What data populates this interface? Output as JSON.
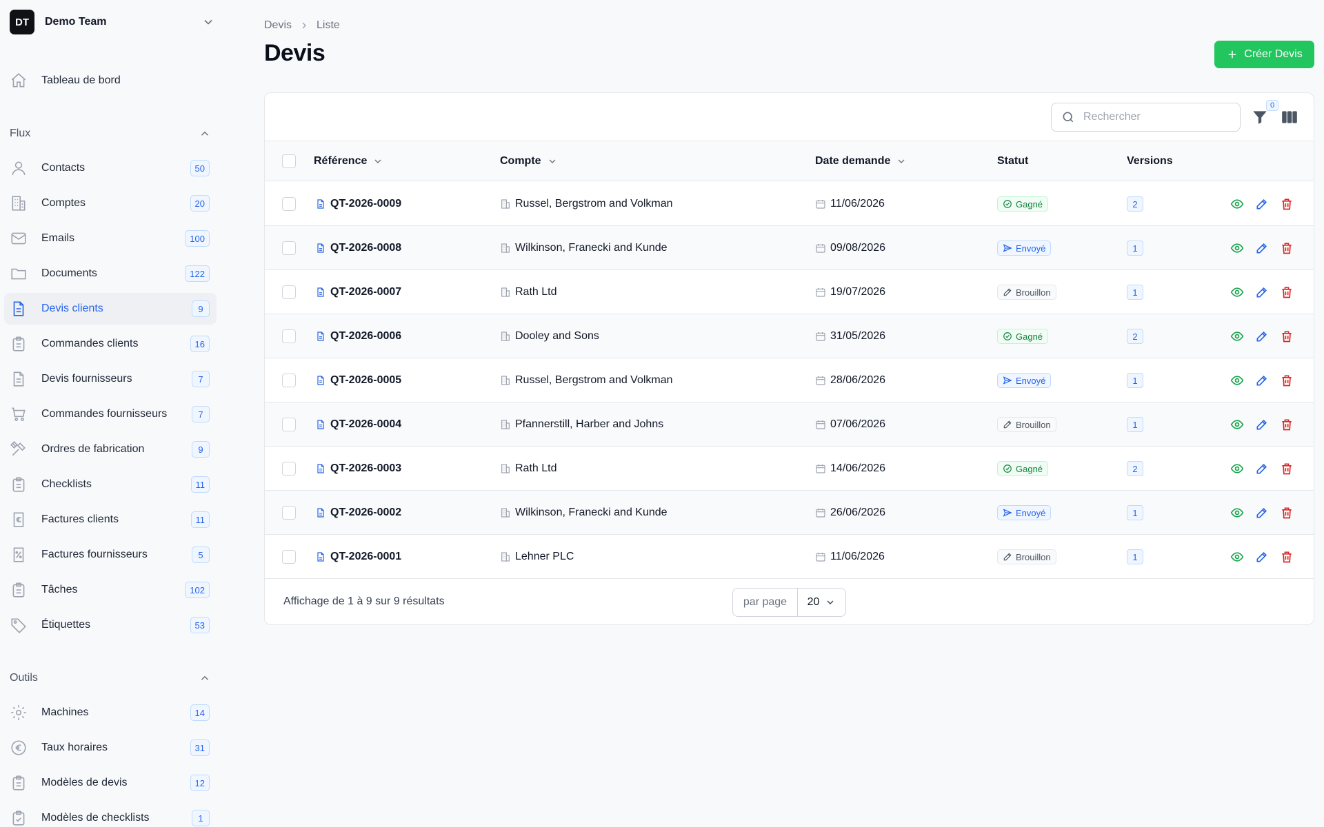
{
  "team": {
    "initials": "DT",
    "name": "Demo Team"
  },
  "nav_top": {
    "label": "Tableau de bord",
    "icon": "home-icon"
  },
  "sections": {
    "flux": "Flux",
    "outils": "Outils"
  },
  "flux_items": [
    {
      "label": "Contacts",
      "count": "50",
      "icon": "user-icon"
    },
    {
      "label": "Comptes",
      "count": "20",
      "icon": "building-icon"
    },
    {
      "label": "Emails",
      "count": "100",
      "icon": "mail-icon"
    },
    {
      "label": "Documents",
      "count": "122",
      "icon": "folder-icon"
    },
    {
      "label": "Devis clients",
      "count": "9",
      "icon": "document-icon",
      "active": true
    },
    {
      "label": "Commandes clients",
      "count": "16",
      "icon": "clipboard-icon"
    },
    {
      "label": "Devis fournisseurs",
      "count": "7",
      "icon": "document-icon"
    },
    {
      "label": "Commandes fournisseurs",
      "count": "7",
      "icon": "cart-icon"
    },
    {
      "label": "Ordres de fabrication",
      "count": "9",
      "icon": "tools-icon"
    },
    {
      "label": "Checklists",
      "count": "11",
      "icon": "clipboard-icon"
    },
    {
      "label": "Factures clients",
      "count": "11",
      "icon": "invoice-euro-icon"
    },
    {
      "label": "Factures fournisseurs",
      "count": "5",
      "icon": "invoice-percent-icon"
    },
    {
      "label": "Tâches",
      "count": "102",
      "icon": "clipboard-icon"
    },
    {
      "label": "Étiquettes",
      "count": "53",
      "icon": "tag-icon"
    }
  ],
  "outils_items": [
    {
      "label": "Machines",
      "count": "14",
      "icon": "gear-icon"
    },
    {
      "label": "Taux horaires",
      "count": "31",
      "icon": "euro-icon"
    },
    {
      "label": "Modèles de devis",
      "count": "12",
      "icon": "clipboard-icon"
    },
    {
      "label": "Modèles de checklists",
      "count": "1",
      "icon": "clipboard-check-icon"
    }
  ],
  "breadcrumb": {
    "root": "Devis",
    "current": "Liste"
  },
  "page_title": "Devis",
  "create_button": "Créer Devis",
  "search": {
    "placeholder": "Rechercher",
    "value": ""
  },
  "filter_count": "0",
  "columns": {
    "reference": "Référence",
    "account": "Compte",
    "date": "Date demande",
    "status": "Statut",
    "versions": "Versions"
  },
  "rows": [
    {
      "ref": "QT-2026-0009",
      "account": "Russel, Bergstrom and Volkman",
      "date": "11/06/2026",
      "status": "Gagné",
      "status_kind": "won",
      "versions": "2"
    },
    {
      "ref": "QT-2026-0008",
      "account": "Wilkinson, Franecki and Kunde",
      "date": "09/08/2026",
      "status": "Envoyé",
      "status_kind": "sent",
      "versions": "1"
    },
    {
      "ref": "QT-2026-0007",
      "account": "Rath Ltd",
      "date": "19/07/2026",
      "status": "Brouillon",
      "status_kind": "draft",
      "versions": "1"
    },
    {
      "ref": "QT-2026-0006",
      "account": "Dooley and Sons",
      "date": "31/05/2026",
      "status": "Gagné",
      "status_kind": "won",
      "versions": "2"
    },
    {
      "ref": "QT-2026-0005",
      "account": "Russel, Bergstrom and Volkman",
      "date": "28/06/2026",
      "status": "Envoyé",
      "status_kind": "sent",
      "versions": "1"
    },
    {
      "ref": "QT-2026-0004",
      "account": "Pfannerstill, Harber and Johns",
      "date": "07/06/2026",
      "status": "Brouillon",
      "status_kind": "draft",
      "versions": "1"
    },
    {
      "ref": "QT-2026-0003",
      "account": "Rath Ltd",
      "date": "14/06/2026",
      "status": "Gagné",
      "status_kind": "won",
      "versions": "2"
    },
    {
      "ref": "QT-2026-0002",
      "account": "Wilkinson, Franecki and Kunde",
      "date": "26/06/2026",
      "status": "Envoyé",
      "status_kind": "sent",
      "versions": "1"
    },
    {
      "ref": "QT-2026-0001",
      "account": "Lehner PLC",
      "date": "11/06/2026",
      "status": "Brouillon",
      "status_kind": "draft",
      "versions": "1"
    }
  ],
  "footer": {
    "results": "Affichage de 1 à 9 sur 9 résultats",
    "per_page_label": "par page",
    "per_page_value": "20"
  },
  "colors": {
    "accent": "#2563eb",
    "create": "#22c55e",
    "delete": "#dc2626",
    "view": "#16a34a"
  }
}
